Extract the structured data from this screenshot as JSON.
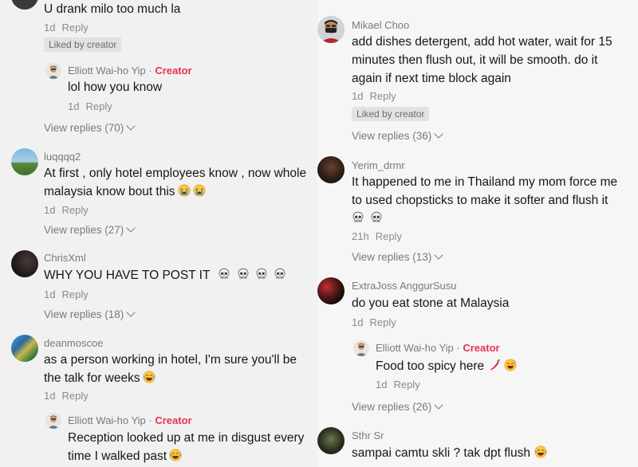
{
  "left": {
    "c0": {
      "text": "U drank milo too much la",
      "time": "1d",
      "reply": "Reply",
      "liked": "Liked by creator"
    },
    "r0": {
      "user": "Elliott Wai-ho Yip",
      "sep": " · ",
      "badge": "Creator",
      "text": "lol how you know",
      "time": "1d",
      "reply": "Reply"
    },
    "vr0": "View replies (70)",
    "c1": {
      "user": "luqqqq2",
      "text": "At first , only hotel employees know , now whole malaysia know bout this",
      "time": "1d",
      "reply": "Reply"
    },
    "vr1": "View replies (27)",
    "c2": {
      "user": "ChrisXml",
      "text": "WHY YOU HAVE TO POST IT",
      "time": "1d",
      "reply": "Reply"
    },
    "vr2": "View replies (18)",
    "c3": {
      "user": "deanmoscoe",
      "text": "as a person working in hotel, I'm sure you'll be the talk for weeks",
      "time": "1d",
      "reply": "Reply"
    },
    "r3": {
      "user": "Elliott Wai-ho Yip",
      "sep": " · ",
      "badge": "Creator",
      "text": "Reception looked up at me in disgust every time I walked past"
    }
  },
  "right": {
    "c0": {
      "user": "Mikael Choo",
      "text": "add dishes detergent, add hot water, wait for 15 minutes then flush out, it will be smooth. do it again if next time block again",
      "time": "1d",
      "reply": "Reply",
      "liked": "Liked by creator"
    },
    "vr0": "View replies (36)",
    "c1": {
      "user": "Yerim_drmr",
      "text": "It happened to me in Thailand my mom force me to used chopsticks to make it softer and flush it",
      "time": "21h",
      "reply": "Reply"
    },
    "vr1": "View replies (13)",
    "c2": {
      "user": "ExtraJoss AnggurSusu",
      "text": "do you eat stone at Malaysia",
      "time": "1d",
      "reply": "Reply"
    },
    "r2": {
      "user": "Elliott Wai-ho Yip",
      "sep": " · ",
      "badge": "Creator",
      "text": "Food too spicy here",
      "time": "1d",
      "reply": "Reply"
    },
    "vr2": "View replies (26)",
    "c3": {
      "user": "Sthr Sr",
      "text": "sampai camtu skli ? tak dpt flush"
    }
  },
  "icons": [
    "skull-emoji",
    "loudly-crying-emoji",
    "tears-of-joy-emoji",
    "chili-pepper-emoji",
    "grinning-sweat-emoji",
    "chevron-down-icon"
  ],
  "colors": {
    "creator": "#e8334a",
    "meta": "#8a8a8a",
    "text": "#161616"
  }
}
